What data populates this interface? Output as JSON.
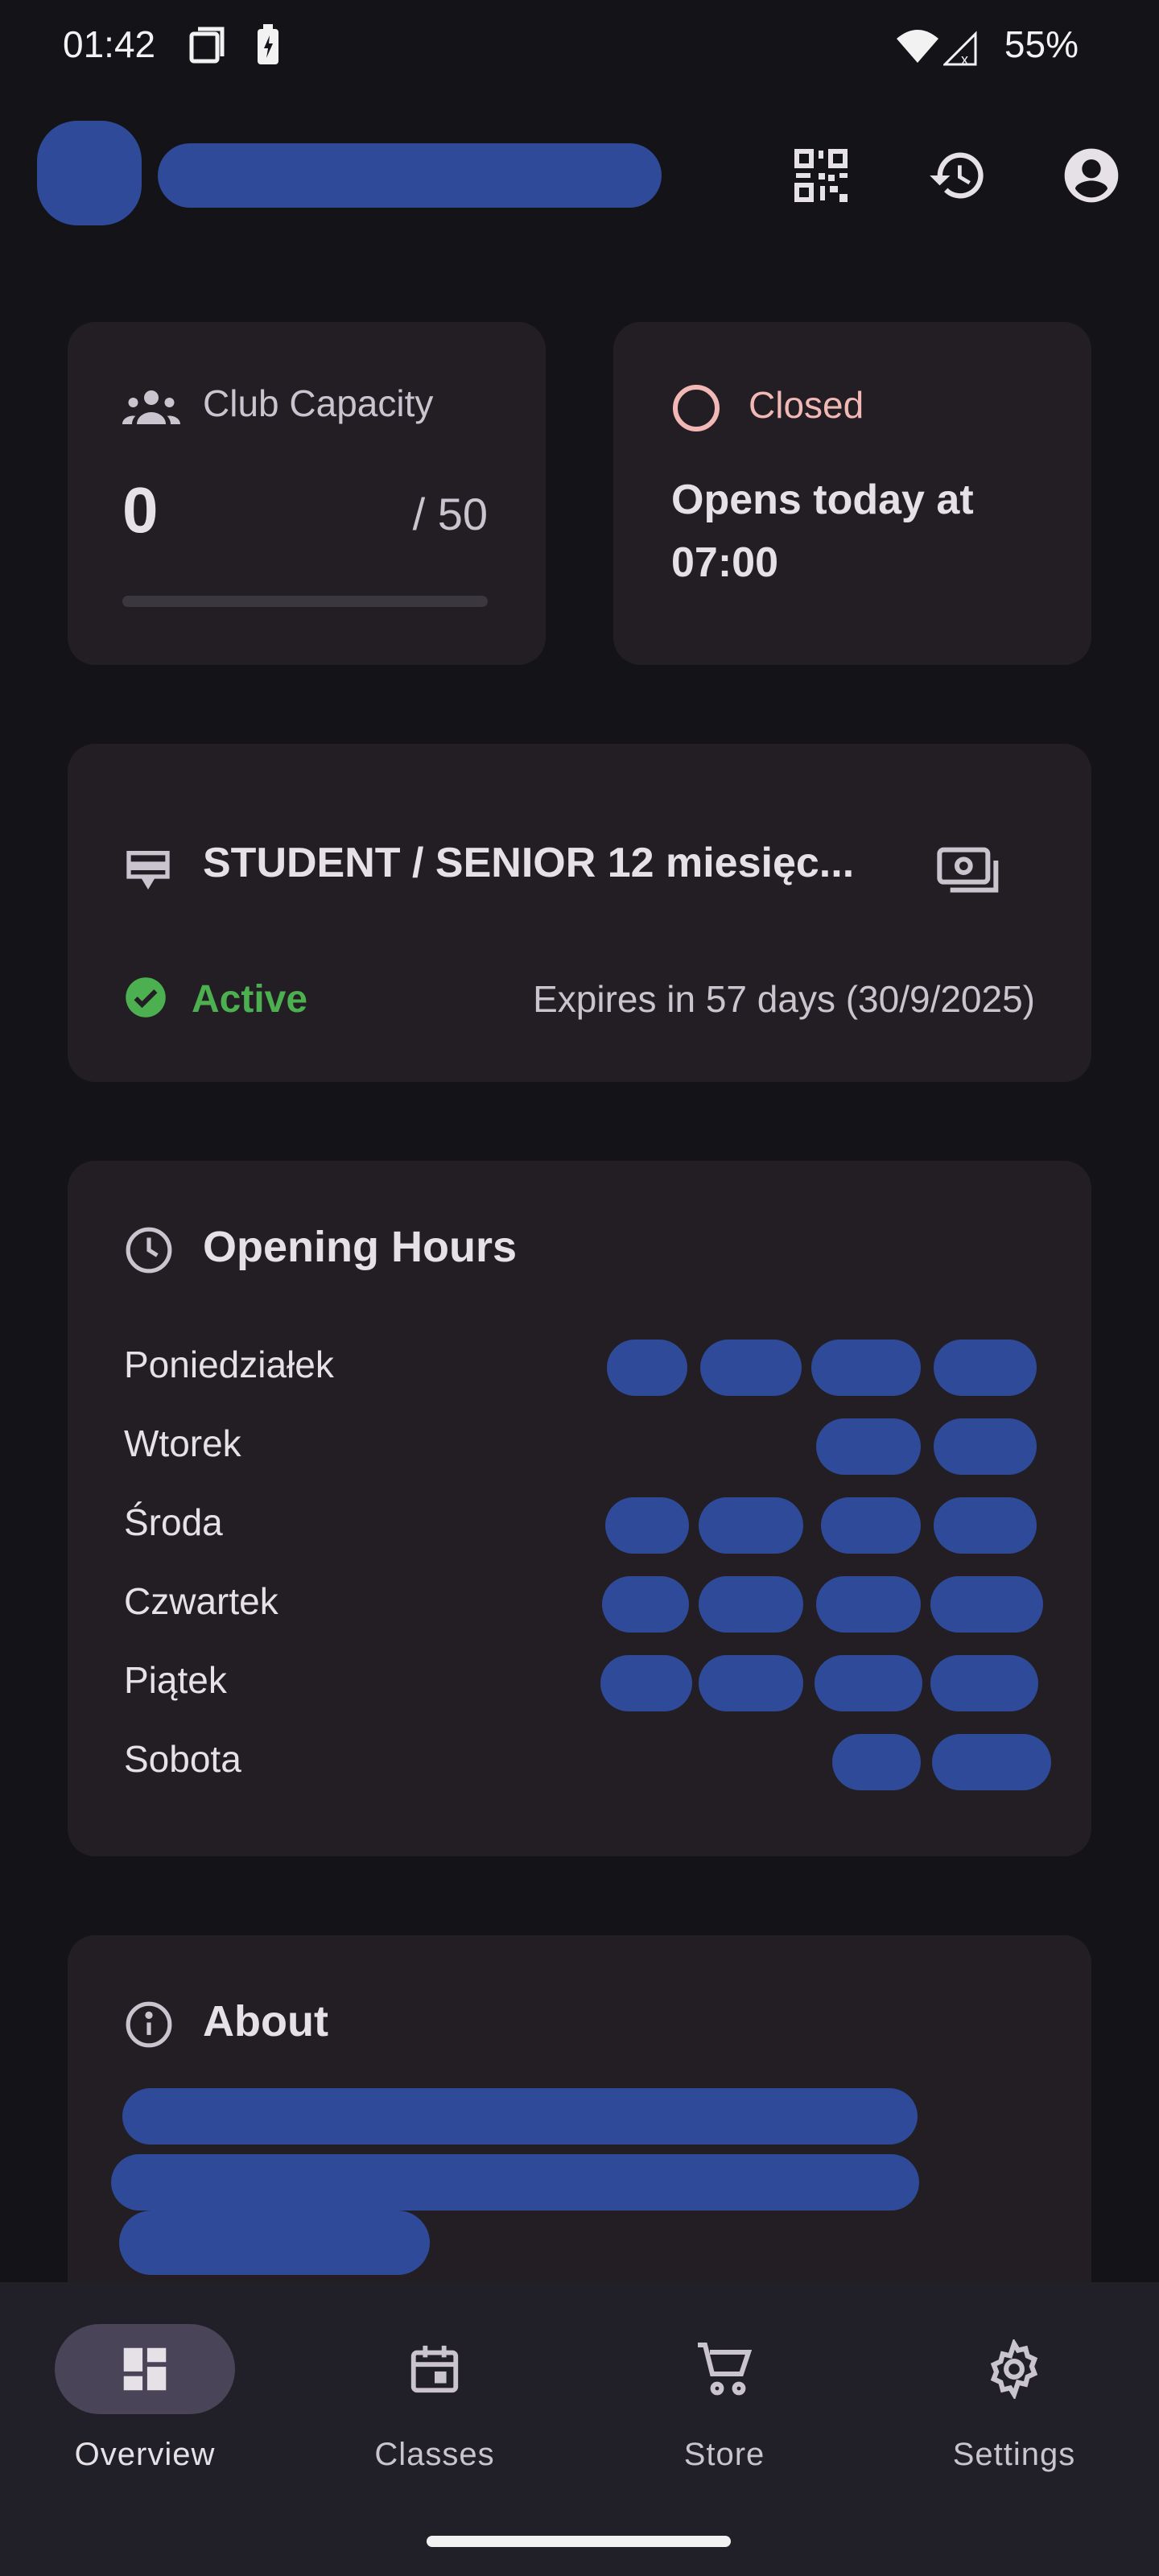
{
  "status_bar": {
    "time": "01:42",
    "battery": "55%"
  },
  "capacity": {
    "title": "Club Capacity",
    "current": "0",
    "max": "/ 50",
    "fill": 0
  },
  "club_status": {
    "state": "Closed",
    "message": "Opens today at 07:00"
  },
  "membership": {
    "name": "STUDENT / SENIOR 12 miesięc...",
    "status": "Active",
    "expires": "Expires in 57 days (30/9/2025)"
  },
  "opening_hours": {
    "title": "Opening Hours",
    "days": [
      "Poniedziałek",
      "Wtorek",
      "Środa",
      "Czwartek",
      "Piątek",
      "Sobota"
    ]
  },
  "about": {
    "title": "About"
  },
  "nav": {
    "items": [
      {
        "label": "Overview",
        "icon": "dashboard-icon",
        "active": true
      },
      {
        "label": "Classes",
        "icon": "calendar-icon",
        "active": false
      },
      {
        "label": "Store",
        "icon": "cart-icon",
        "active": false
      },
      {
        "label": "Settings",
        "icon": "gear-icon",
        "active": false
      }
    ]
  },
  "colors": {
    "background": "#141318",
    "card": "#221e24",
    "closed": "#f2b8b5",
    "active": "#4caf50",
    "redaction": "#2f4a98",
    "nav_pill": "#4a4458"
  }
}
